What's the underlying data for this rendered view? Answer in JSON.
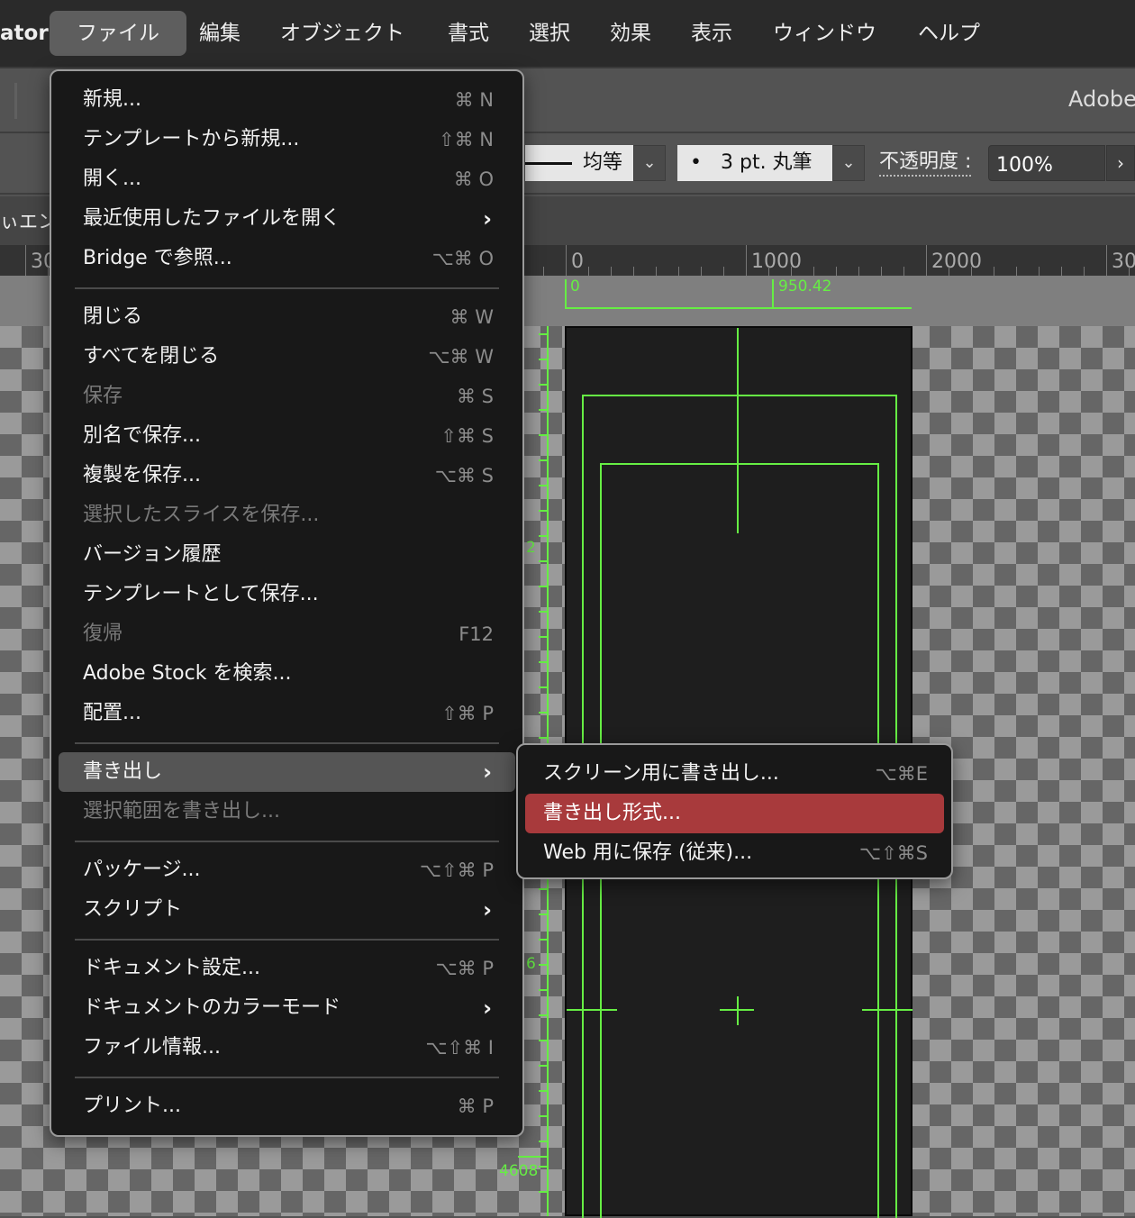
{
  "menubar": {
    "app_name_partial": "ator",
    "items": [
      "ファイル",
      "編集",
      "オブジェクト",
      "書式",
      "選択",
      "効果",
      "表示",
      "ウィンドウ",
      "ヘルプ"
    ]
  },
  "toolbar": {
    "adobe_label": "Adobe",
    "stroke_profile": "均等",
    "brush": "3 pt. 丸筆",
    "brush_dot": "•",
    "opacity_label": "不透明度 :",
    "opacity_value": "100%",
    "left_panel_partial": "ぃエン",
    "left_ruler_partial": "30"
  },
  "ruler": {
    "labels": [
      "0",
      "1000",
      "2000",
      "30"
    ],
    "artboard_start": "0",
    "artboard_width": "950.42",
    "vertical_labels": [
      "2",
      "6",
      "4608"
    ]
  },
  "file_menu": {
    "groups": [
      [
        {
          "label": "新規...",
          "shortcut": "⌘ N"
        },
        {
          "label": "テンプレートから新規...",
          "shortcut": "⇧⌘ N"
        },
        {
          "label": "開く...",
          "shortcut": "⌘ O"
        },
        {
          "label": "最近使用したファイルを開く",
          "submenu": true
        },
        {
          "label": "Bridge で参照...",
          "shortcut": "⌥⌘ O"
        }
      ],
      [
        {
          "label": "閉じる",
          "shortcut": "⌘ W"
        },
        {
          "label": "すべてを閉じる",
          "shortcut": "⌥⌘ W"
        },
        {
          "label": "保存",
          "shortcut": "⌘ S",
          "disabled": true
        },
        {
          "label": "別名で保存...",
          "shortcut": "⇧⌘ S"
        },
        {
          "label": "複製を保存...",
          "shortcut": "⌥⌘ S"
        },
        {
          "label": "選択したスライスを保存...",
          "disabled": true
        },
        {
          "label": "バージョン履歴"
        },
        {
          "label": "テンプレートとして保存..."
        },
        {
          "label": "復帰",
          "shortcut": "F12",
          "disabled": true
        },
        {
          "label": "Adobe Stock を検索..."
        },
        {
          "label": "配置...",
          "shortcut": "⇧⌘ P"
        }
      ],
      [
        {
          "label": "書き出し",
          "submenu": true,
          "highlighted": true
        },
        {
          "label": "選択範囲を書き出し...",
          "disabled": true
        }
      ],
      [
        {
          "label": "パッケージ...",
          "shortcut": "⌥⇧⌘ P"
        },
        {
          "label": "スクリプト",
          "submenu": true
        }
      ],
      [
        {
          "label": "ドキュメント設定...",
          "shortcut": "⌥⌘ P"
        },
        {
          "label": "ドキュメントのカラーモード",
          "submenu": true
        },
        {
          "label": "ファイル情報...",
          "shortcut": "⌥⇧⌘ I"
        }
      ],
      [
        {
          "label": "プリント...",
          "shortcut": "⌘ P"
        }
      ]
    ]
  },
  "export_submenu": {
    "items": [
      {
        "label": "スクリーン用に書き出し...",
        "shortcut": "⌥⌘E"
      },
      {
        "label": "書き出し形式...",
        "selected": true
      },
      {
        "label": "Web 用に保存 (従来)...",
        "shortcut": "⌥⇧⌘S"
      }
    ]
  },
  "colors": {
    "guide": "#66ee44",
    "selection": "#a83a3c",
    "menu_bg": "#181818"
  }
}
